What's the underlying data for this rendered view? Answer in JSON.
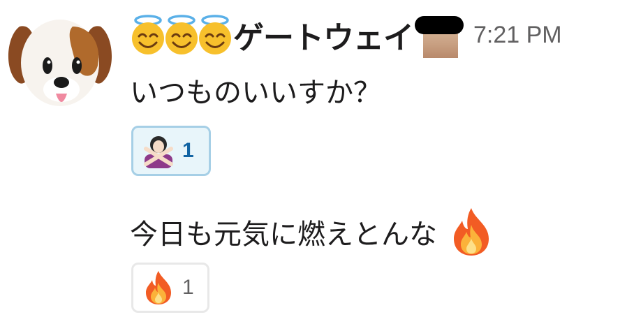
{
  "sender": {
    "avatar_icon": "dog-face-emoji",
    "halo_icons": [
      "smiling-face-with-halo-emoji",
      "smiling-face-with-halo-emoji",
      "smiling-face-with-halo-emoji"
    ],
    "name": "ゲートウェイ",
    "photo_icon": "redacted-profile-photo",
    "timestamp": "7:21 PM"
  },
  "messages": [
    {
      "text": "いつものいいすか？",
      "reactions": [
        {
          "emoji_icon": "person-gesturing-no-emoji",
          "count": "1",
          "active": true
        }
      ]
    },
    {
      "text": "今日も元気に燃えとんな",
      "inline_emoji_icon": "fire-emoji",
      "reactions": [
        {
          "emoji_icon": "fire-emoji",
          "count": "1",
          "active": false
        }
      ]
    }
  ],
  "colors": {
    "text": "#1d1c1d",
    "timestamp": "#616061",
    "active_reaction_bg": "#e8f5fa",
    "active_reaction_border": "#a6cfe6",
    "active_reaction_count": "#1264a3",
    "inactive_reaction_border": "#e8e8e8"
  }
}
